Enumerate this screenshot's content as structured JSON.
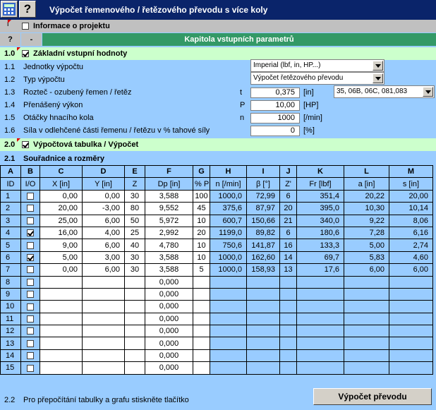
{
  "title": {
    "help_glyph": "?",
    "text": "Výpočet řemenového / řetězového převodu s více koly"
  },
  "info_row": {
    "num": "i",
    "label": "Informace o projektu",
    "checked": false
  },
  "chapter_row": {
    "q": "?",
    "minus": "-",
    "label": "Kapitola vstupních parametrů"
  },
  "section1": {
    "num": "1.0",
    "label": "Základní vstupní hodnoty",
    "checked": true
  },
  "params": [
    {
      "num": "1.1",
      "label": "Jednotky výpočtu"
    },
    {
      "num": "1.2",
      "label": "Typ výpočtu"
    },
    {
      "num": "1.3",
      "label": "Rozteč - ozubený řemen / řetěz",
      "sym": "t",
      "value": "0,375",
      "unit": "[in]"
    },
    {
      "num": "1.4",
      "label": "Přenášený výkon",
      "sym": "P",
      "value": "10,00",
      "unit": "[HP]"
    },
    {
      "num": "1.5",
      "label": "Otáčky hnacího kola",
      "sym": "n",
      "value": "1000",
      "unit": "[/min]"
    },
    {
      "num": "1.6",
      "label": "Síla v odlehčené části řemenu / řetězu v % tahové síly",
      "value": "0",
      "unit": "[%]"
    }
  ],
  "combos": {
    "units": "Imperial (lbf, in, HP...)",
    "type": "Výpočet řetězového převodu",
    "pitch": "35, 06B, 06C, 081,083"
  },
  "section2": {
    "num": "2.0",
    "label": "Výpočtová tabulka / Výpočet",
    "checked": true
  },
  "section21": {
    "num": "2.1",
    "label": "Souřadnice a rozměry"
  },
  "table": {
    "letters": [
      "A",
      "B",
      "C",
      "D",
      "E",
      "F",
      "G",
      "H",
      "I",
      "J",
      "K",
      "L",
      "M"
    ],
    "headers": [
      "ID",
      "I/O",
      "X [in]",
      "Y [in]",
      "Z",
      "Dp [in]",
      "% P",
      "n [/min]",
      "β [°]",
      "Z'",
      "Fr [lbf]",
      "a [in]",
      "s [in]"
    ],
    "rows": [
      {
        "id": "1",
        "io": false,
        "x": "0,00",
        "y": "0,00",
        "z": "30",
        "dp": "3,588",
        "p": "100",
        "n": "1000,0",
        "b": "72,99",
        "z2": "6",
        "fr": "351,4",
        "a": "20,22",
        "s": "20,00"
      },
      {
        "id": "2",
        "io": false,
        "x": "20,00",
        "y": "-3,00",
        "z": "80",
        "dp": "9,552",
        "p": "45",
        "n": "375,6",
        "b": "87,97",
        "z2": "20",
        "fr": "395,0",
        "a": "10,30",
        "s": "10,14"
      },
      {
        "id": "3",
        "io": false,
        "x": "25,00",
        "y": "6,00",
        "z": "50",
        "dp": "5,972",
        "p": "10",
        "n": "600,7",
        "b": "150,66",
        "z2": "21",
        "fr": "340,0",
        "a": "9,22",
        "s": "8,06"
      },
      {
        "id": "4",
        "io": true,
        "x": "16,00",
        "y": "4,00",
        "z": "25",
        "dp": "2,992",
        "p": "20",
        "n": "1199,0",
        "b": "89,82",
        "z2": "6",
        "fr": "180,6",
        "a": "7,28",
        "s": "6,16"
      },
      {
        "id": "5",
        "io": false,
        "x": "9,00",
        "y": "6,00",
        "z": "40",
        "dp": "4,780",
        "p": "10",
        "n": "750,6",
        "b": "141,87",
        "z2": "16",
        "fr": "133,3",
        "a": "5,00",
        "s": "2,74"
      },
      {
        "id": "6",
        "io": true,
        "x": "5,00",
        "y": "3,00",
        "z": "30",
        "dp": "3,588",
        "p": "10",
        "n": "1000,0",
        "b": "162,60",
        "z2": "14",
        "fr": "69,7",
        "a": "5,83",
        "s": "4,60"
      },
      {
        "id": "7",
        "io": false,
        "x": "0,00",
        "y": "6,00",
        "z": "30",
        "dp": "3,588",
        "p": "5",
        "n": "1000,0",
        "b": "158,93",
        "z2": "13",
        "fr": "17,6",
        "a": "6,00",
        "s": "6,00"
      },
      {
        "id": "8",
        "io": false,
        "x": "",
        "y": "",
        "z": "",
        "dp": "0,000",
        "p": "",
        "n": "",
        "b": "",
        "z2": "",
        "fr": "",
        "a": "",
        "s": ""
      },
      {
        "id": "9",
        "io": false,
        "x": "",
        "y": "",
        "z": "",
        "dp": "0,000",
        "p": "",
        "n": "",
        "b": "",
        "z2": "",
        "fr": "",
        "a": "",
        "s": ""
      },
      {
        "id": "10",
        "io": false,
        "x": "",
        "y": "",
        "z": "",
        "dp": "0,000",
        "p": "",
        "n": "",
        "b": "",
        "z2": "",
        "fr": "",
        "a": "",
        "s": ""
      },
      {
        "id": "11",
        "io": false,
        "x": "",
        "y": "",
        "z": "",
        "dp": "0,000",
        "p": "",
        "n": "",
        "b": "",
        "z2": "",
        "fr": "",
        "a": "",
        "s": ""
      },
      {
        "id": "12",
        "io": false,
        "x": "",
        "y": "",
        "z": "",
        "dp": "0,000",
        "p": "",
        "n": "",
        "b": "",
        "z2": "",
        "fr": "",
        "a": "",
        "s": ""
      },
      {
        "id": "13",
        "io": false,
        "x": "",
        "y": "",
        "z": "",
        "dp": "0,000",
        "p": "",
        "n": "",
        "b": "",
        "z2": "",
        "fr": "",
        "a": "",
        "s": ""
      },
      {
        "id": "14",
        "io": false,
        "x": "",
        "y": "",
        "z": "",
        "dp": "0,000",
        "p": "",
        "n": "",
        "b": "",
        "z2": "",
        "fr": "",
        "a": "",
        "s": ""
      },
      {
        "id": "15",
        "io": false,
        "x": "",
        "y": "",
        "z": "",
        "dp": "0,000",
        "p": "",
        "n": "",
        "b": "",
        "z2": "",
        "fr": "",
        "a": "",
        "s": ""
      }
    ]
  },
  "footer": {
    "num": "2.2",
    "label": "Pro přepočítání tabulky a grafu stiskněte tlačítko",
    "button": "Výpočet převodu"
  }
}
